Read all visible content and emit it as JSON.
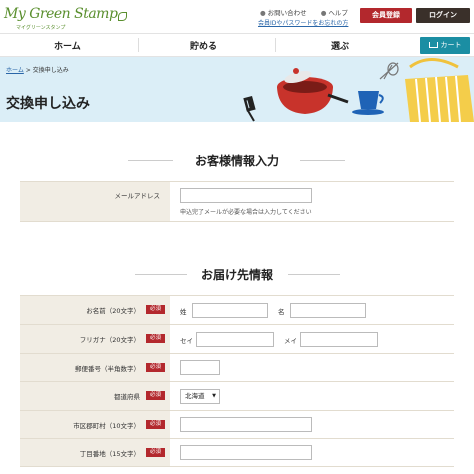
{
  "header": {
    "logo_text": "My Green Stamp",
    "logo_sub": "マイグリーンスタンプ",
    "util_links": [
      "お問い合わせ",
      "ヘルプ"
    ],
    "forgot_link": "会員IDやパスワードをお忘れの方",
    "register_label": "会員登録",
    "login_label": "ログイン"
  },
  "nav": {
    "items": [
      "ホーム",
      "貯める",
      "選ぶ"
    ],
    "cart_label": "カート"
  },
  "hero": {
    "breadcrumb_home": "ホーム",
    "breadcrumb_sep": ">",
    "breadcrumb_current": "交換申し込み",
    "title": "交換申し込み"
  },
  "customer_section": {
    "heading": "お客様情報入力",
    "email_label": "メールアドレス",
    "email_value": "",
    "email_hint": "申込完了メールが必要な場合は入力してください"
  },
  "delivery_section": {
    "heading": "お届け先情報",
    "required_badge": "必須",
    "rows": {
      "name": {
        "label": "お名前（20文字）",
        "first": "姓",
        "last": "名"
      },
      "kana": {
        "label": "フリガナ（20文字）",
        "first": "セイ",
        "last": "メイ"
      },
      "postal": {
        "label": "郵便番号（半角数字）"
      },
      "prefecture": {
        "label": "都道府県",
        "selected": "北海道"
      },
      "city": {
        "label": "市区郡町村（10文字）"
      },
      "street": {
        "label": "丁目番地（15文字）"
      }
    }
  },
  "colors": {
    "brand_green": "#5a8f2e",
    "register_red": "#b3282d",
    "login_dark": "#3a302a",
    "cart_teal": "#1b8ea3",
    "hero_bg": "#dbeef7",
    "label_bg": "#f1ede4"
  }
}
